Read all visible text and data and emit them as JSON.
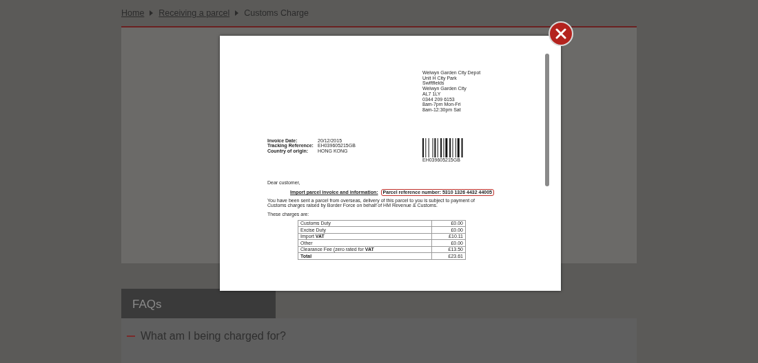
{
  "breadcrumb": [
    {
      "label": "Home",
      "kind": "link"
    },
    {
      "label": "Receiving a parcel",
      "kind": "link"
    },
    {
      "label": "Customs Charge",
      "kind": "current"
    }
  ],
  "modal": {
    "document": {
      "address": [
        "Welwyn Garden City Depot",
        "Unit H City Park",
        "Swiftfields",
        "Welwyn Garden City",
        "AL7 1LY",
        "0344 209 6153",
        "8am-7pm Mon-Fri",
        "8am-12:30pm Sat"
      ],
      "fields": [
        {
          "label": "Invoice Date:",
          "value": "20/12/2015"
        },
        {
          "label": "Tracking Reference:",
          "value": "EH039605215GB"
        },
        {
          "label": "Country of origin:",
          "value": "HONG KONG"
        }
      ],
      "barcode_text": "EH039605215GB",
      "greeting": "Dear customer,",
      "heading": "Import parcel invoice and information:",
      "reference": "Parcel reference number: 5310 1326 4432 44005",
      "paragraph": "You have been sent a parcel from overseas, delivery of this parcel to you is subject to payment of Customs charges raised by Border Force on behalf of HM Revenue & Customs.",
      "charges_intro": "These charges are:",
      "charges": [
        {
          "label": "Customs Duty",
          "amount": "£0.00",
          "kind": "item"
        },
        {
          "label": "Excise Duty",
          "amount": "£0.00",
          "kind": "item"
        },
        {
          "label": "Import **VAT**",
          "amount": "£10.11",
          "kind": "item"
        },
        {
          "label": "Other",
          "amount": "£0.00",
          "kind": "item"
        },
        {
          "label": "Clearance Fee (zero rated for **VAT**",
          "amount": "£13.50",
          "kind": "item"
        },
        {
          "label": "Total",
          "amount": "£23.61",
          "kind": "total"
        }
      ]
    }
  },
  "faq": {
    "title": "FAQs",
    "items": [
      {
        "question": "What am I being charged for?",
        "expanded": true
      }
    ]
  }
}
